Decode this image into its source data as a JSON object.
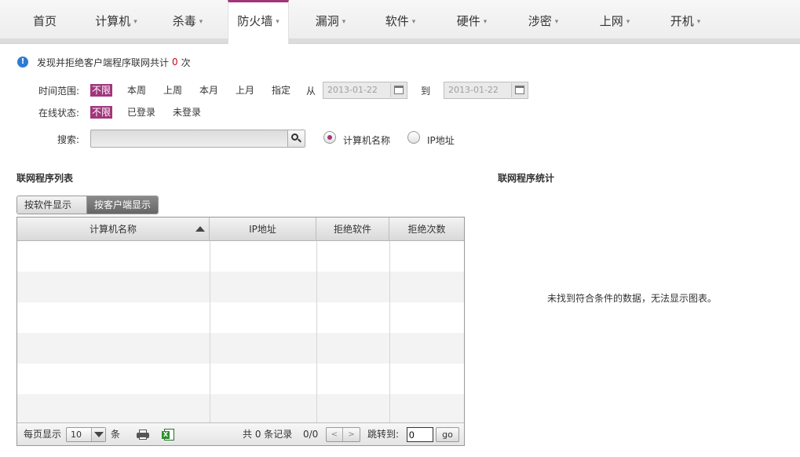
{
  "nav": {
    "tabs": [
      {
        "label": "首页",
        "arrow": ""
      },
      {
        "label": "计算机",
        "arrow": "▾"
      },
      {
        "label": "杀毒",
        "arrow": "▾"
      },
      {
        "label": "防火墙",
        "arrow": "▾"
      },
      {
        "label": "漏洞",
        "arrow": "▾"
      },
      {
        "label": "软件",
        "arrow": "▾"
      },
      {
        "label": "硬件",
        "arrow": "▾"
      },
      {
        "label": "涉密",
        "arrow": "▾"
      },
      {
        "label": "上网",
        "arrow": "▾"
      },
      {
        "label": "开机",
        "arrow": "▾"
      }
    ],
    "active_tab": "防火墙"
  },
  "notice": {
    "icon": "info-icon",
    "prefix": "发现并拒绝客户端程序联网共计",
    "count": "0",
    "suffix": "次"
  },
  "filters": {
    "time_label": "时间范围:",
    "time_options": [
      "不限",
      "本周",
      "上周",
      "本月",
      "上月",
      "指定"
    ],
    "from_label": "从",
    "to_label": "到",
    "from_date": "2013-01-22",
    "to_date": "2013-01-22",
    "status_label": "在线状态:",
    "status_options": [
      "不限",
      "已登录",
      "未登录"
    ],
    "search_label": "搜索:",
    "search_value": "",
    "radio_computer": "计算机名称",
    "radio_ip": "IP地址"
  },
  "list": {
    "title": "联网程序列表",
    "view_by_software": "按软件显示",
    "view_by_client": "按客户端显示",
    "columns": [
      "计算机名称",
      "IP地址",
      "拒绝软件",
      "拒绝次数"
    ],
    "rows": []
  },
  "footer": {
    "per_page_label": "每页显示",
    "per_page_value": "10",
    "per_page_unit": "条",
    "total_text": "共 0 条记录",
    "page_text": "0/0",
    "prev": "<",
    "next": ">",
    "jump_label": "跳转到:",
    "jump_value": "0",
    "go_label": "go"
  },
  "stats": {
    "title": "联网程序统计",
    "empty_message": "未找到符合条件的数据，无法显示图表。"
  },
  "colors": {
    "accent": "#a2357c",
    "notice_count": "#d0021b",
    "info_icon": "#2c7bd4"
  }
}
